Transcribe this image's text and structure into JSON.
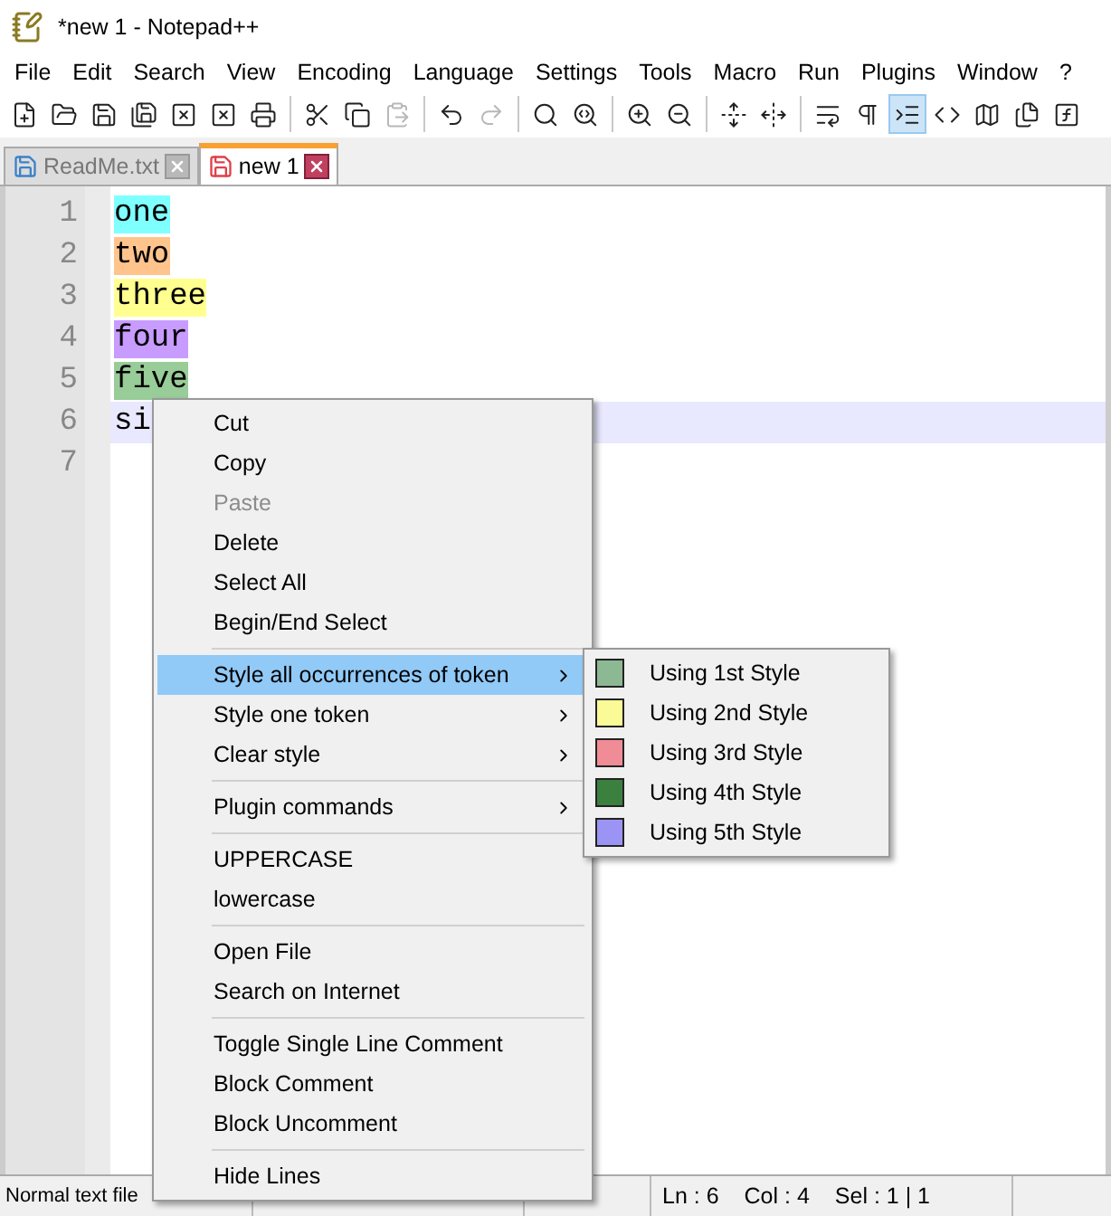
{
  "window": {
    "title": "*new 1 - Notepad++"
  },
  "menu_bar": [
    "File",
    "Edit",
    "Search",
    "View",
    "Encoding",
    "Language",
    "Settings",
    "Tools",
    "Macro",
    "Run",
    "Plugins",
    "Window",
    "?"
  ],
  "toolbar": [
    {
      "kind": "button",
      "disabled": false,
      "selected": false
    },
    {
      "kind": "button",
      "disabled": false,
      "selected": false
    },
    {
      "kind": "button",
      "disabled": false,
      "selected": false
    },
    {
      "kind": "button",
      "disabled": false,
      "selected": false
    },
    {
      "kind": "button",
      "disabled": false,
      "selected": false
    },
    {
      "kind": "button",
      "disabled": false,
      "selected": false
    },
    {
      "kind": "button",
      "disabled": false,
      "selected": false
    },
    {
      "kind": "separator"
    },
    {
      "kind": "button",
      "disabled": false,
      "selected": false
    },
    {
      "kind": "button",
      "disabled": false,
      "selected": false
    },
    {
      "kind": "button",
      "disabled": true,
      "selected": false
    },
    {
      "kind": "separator"
    },
    {
      "kind": "button",
      "disabled": false,
      "selected": false
    },
    {
      "kind": "button",
      "disabled": true,
      "selected": false
    },
    {
      "kind": "separator"
    },
    {
      "kind": "button",
      "disabled": false,
      "selected": false
    },
    {
      "kind": "button",
      "disabled": false,
      "selected": false
    },
    {
      "kind": "separator"
    },
    {
      "kind": "button",
      "disabled": false,
      "selected": false
    },
    {
      "kind": "button",
      "disabled": false,
      "selected": false
    },
    {
      "kind": "separator"
    },
    {
      "kind": "button",
      "disabled": false,
      "selected": false
    },
    {
      "kind": "button",
      "disabled": false,
      "selected": false
    },
    {
      "kind": "separator"
    },
    {
      "kind": "button",
      "disabled": false,
      "selected": false
    },
    {
      "kind": "button",
      "disabled": false,
      "selected": false
    },
    {
      "kind": "button",
      "disabled": false,
      "selected": true
    },
    {
      "kind": "button",
      "disabled": false,
      "selected": false
    },
    {
      "kind": "button",
      "disabled": false,
      "selected": false
    },
    {
      "kind": "button",
      "disabled": false,
      "selected": false
    },
    {
      "kind": "button",
      "disabled": false,
      "selected": false
    }
  ],
  "tabs": [
    {
      "label": "ReadMe.txt",
      "selected": false,
      "color": "#3c82c8"
    },
    {
      "label": "new 1",
      "selected": true,
      "color": "#e0404a"
    }
  ],
  "editor": {
    "lines": [
      {
        "number": "1",
        "text": "one",
        "color": "#80ffff",
        "current": false
      },
      {
        "number": "2",
        "text": "two",
        "color": "#ffc48c",
        "current": false
      },
      {
        "number": "3",
        "text": "three",
        "color": "#ffff90",
        "current": false
      },
      {
        "number": "4",
        "text": "four",
        "color": "#c89cff",
        "current": false
      },
      {
        "number": "5",
        "text": "five",
        "color": "#98cc98",
        "current": false
      },
      {
        "number": "6",
        "text": "si",
        "current": true
      },
      {
        "number": "7",
        "current": false
      }
    ]
  },
  "context_menu": {
    "items": [
      {
        "kind": "item",
        "label": "Cut",
        "disabled": false,
        "selected": false,
        "submenu": false
      },
      {
        "kind": "item",
        "label": "Copy",
        "disabled": false,
        "selected": false,
        "submenu": false
      },
      {
        "kind": "item",
        "label": "Paste",
        "disabled": true,
        "selected": false,
        "submenu": false
      },
      {
        "kind": "item",
        "label": "Delete",
        "disabled": false,
        "selected": false,
        "submenu": false
      },
      {
        "kind": "item",
        "label": "Select All",
        "disabled": false,
        "selected": false,
        "submenu": false
      },
      {
        "kind": "item",
        "label": "Begin/End Select",
        "disabled": false,
        "selected": false,
        "submenu": false
      },
      {
        "kind": "separator"
      },
      {
        "kind": "item",
        "label": "Style all occurrences of token",
        "disabled": false,
        "selected": true,
        "submenu": true
      },
      {
        "kind": "item",
        "label": "Style one token",
        "disabled": false,
        "selected": false,
        "submenu": true
      },
      {
        "kind": "item",
        "label": "Clear style",
        "disabled": false,
        "selected": false,
        "submenu": true
      },
      {
        "kind": "separator"
      },
      {
        "kind": "item",
        "label": "Plugin commands",
        "disabled": false,
        "selected": false,
        "submenu": true
      },
      {
        "kind": "separator"
      },
      {
        "kind": "item",
        "label": "UPPERCASE",
        "disabled": false,
        "selected": false,
        "submenu": false
      },
      {
        "kind": "item",
        "label": "lowercase",
        "disabled": false,
        "selected": false,
        "submenu": false
      },
      {
        "kind": "separator"
      },
      {
        "kind": "item",
        "label": "Open File",
        "disabled": false,
        "selected": false,
        "submenu": false
      },
      {
        "kind": "item",
        "label": "Search on Internet",
        "disabled": false,
        "selected": false,
        "submenu": false
      },
      {
        "kind": "separator"
      },
      {
        "kind": "item",
        "label": "Toggle Single Line Comment",
        "disabled": false,
        "selected": false,
        "submenu": false
      },
      {
        "kind": "item",
        "label": "Block Comment",
        "disabled": false,
        "selected": false,
        "submenu": false
      },
      {
        "kind": "item",
        "label": "Block Uncomment",
        "disabled": false,
        "selected": false,
        "submenu": false
      },
      {
        "kind": "separator"
      },
      {
        "kind": "item",
        "label": "Hide Lines",
        "disabled": false,
        "selected": false,
        "submenu": false
      }
    ]
  },
  "submenu": {
    "items": [
      {
        "label": "Using 1st Style",
        "color": "#8cb894"
      },
      {
        "label": "Using 2nd Style",
        "color": "#fafa96"
      },
      {
        "label": "Using 3rd Style",
        "color": "#f08c96"
      },
      {
        "label": "Using 4th Style",
        "color": "#3c8040"
      },
      {
        "label": "Using 5th Style",
        "color": "#9c94f4"
      }
    ]
  },
  "status_bar": {
    "file_type": "Normal text file",
    "position": [
      "Ln : 6",
      "Col : 4",
      "Sel : 1 | 1"
    ]
  }
}
